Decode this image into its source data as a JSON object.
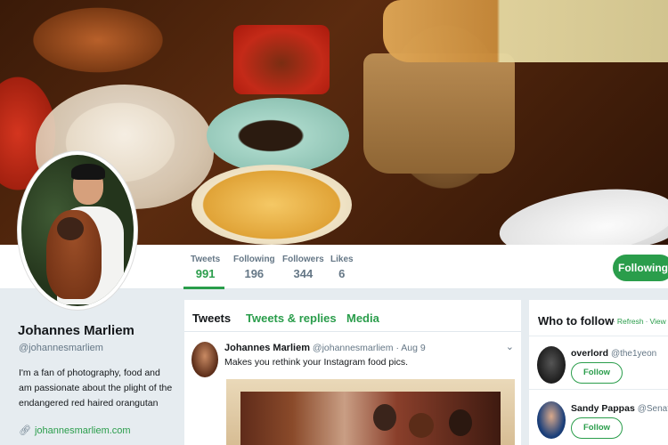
{
  "header": {
    "image_description_icon": "food-photo"
  },
  "profile": {
    "name": "Johannes Marliem",
    "handle": "@johannesmarliem",
    "bio": "I'm a fan of photography, food and am passionate about the plight of the endangered red haired orangutan",
    "website": "johannesmarliem.com"
  },
  "stats": {
    "tweets_label": "Tweets",
    "tweets_value": "991",
    "following_label": "Following",
    "following_value": "196",
    "followers_label": "Followers",
    "followers_value": "344",
    "likes_label": "Likes",
    "likes_value": "6"
  },
  "follow_button": "Following",
  "timeline": {
    "tabs": [
      "Tweets",
      "Tweets & replies",
      "Media"
    ],
    "tweet": {
      "name": "Johannes Marliem",
      "handle": "@johannesmarliem",
      "date": "Aug 9",
      "text": "Makes you rethink your Instagram food pics."
    }
  },
  "who_to_follow": {
    "title": "Who to follow",
    "refresh": "Refresh",
    "view_all": "View all",
    "dot": "·",
    "users": [
      {
        "name": "overlord",
        "handle": "@the1yeon",
        "button": "Follow"
      },
      {
        "name": "Sandy Pappas",
        "handle": "@SenatorP...",
        "button": "Follow"
      }
    ]
  },
  "colors": {
    "accent": "#2a9d4b",
    "muted": "#657786",
    "text": "#14171a"
  }
}
